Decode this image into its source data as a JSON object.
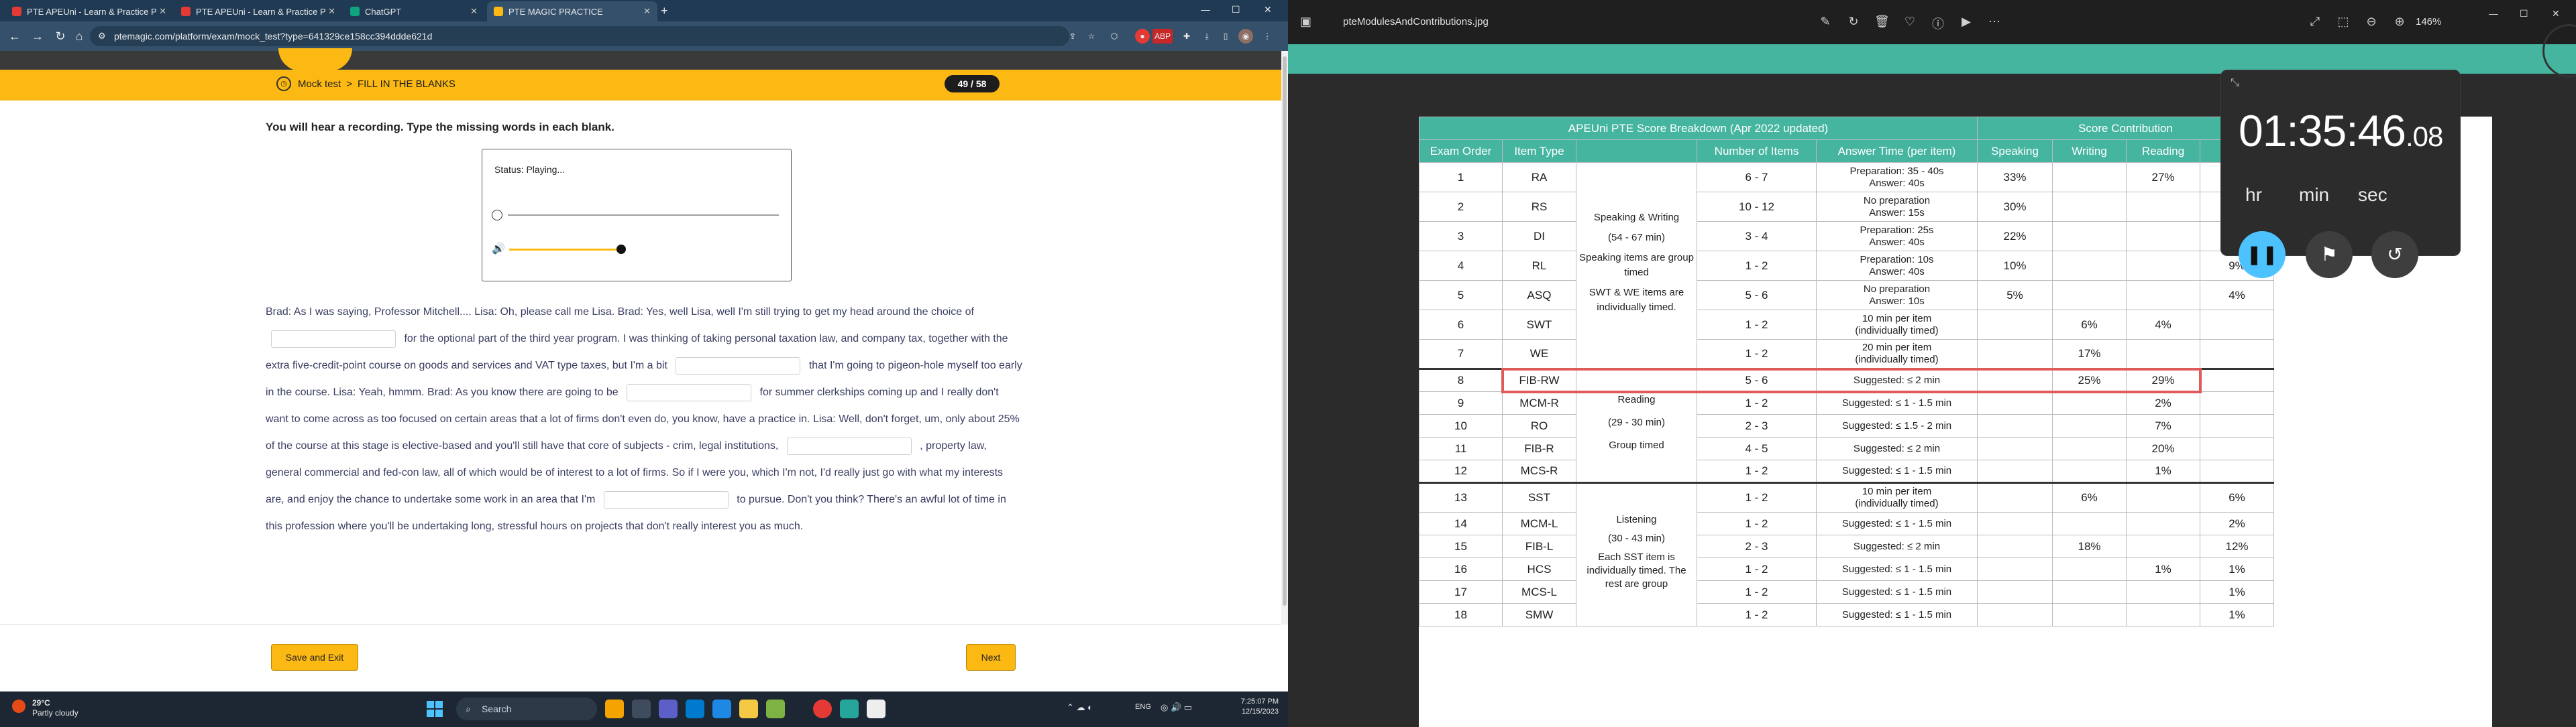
{
  "browser": {
    "tabs": [
      {
        "title": "PTE APEUni - Learn & Practice P",
        "active": false
      },
      {
        "title": "PTE APEUni - Learn & Practice P",
        "active": false
      },
      {
        "title": "PTE MAGIC PRACTICE",
        "active": true
      },
      {
        "title": "ChatGPT",
        "active": false
      }
    ],
    "new_tab": "+",
    "url": "ptemagic.com/platform/exam/mock_test?type=641329ce158cc394ddde621d",
    "window_controls": {
      "minimize": "—",
      "maximize": "☐",
      "close": "✕"
    }
  },
  "exam": {
    "breadcrumb_root": "Mock test",
    "breadcrumb_sep": ">",
    "breadcrumb_section": "FILL IN THE BLANKS",
    "counter": "49 / 58",
    "instruction": "You will hear a recording. Type the missing words in each blank.",
    "player_status": "Status: Playing...",
    "passage": [
      "Brad: As I was saying, Professor Mitchell.... Lisa: Oh, please call me Lisa. Brad: Yes, well Lisa, well I'm still trying to get my head around the choice of",
      "for the optional part of the third year program. I was thinking of taking personal taxation law, and company tax, together with the extra five-credit-point course on goods and services and VAT type taxes, but I'm a bit",
      "that I'm going to pigeon-hole myself too early in the course. Lisa: Yeah, hmmm. Brad: As you know there are going to be",
      "for summer clerkships coming up and I really don't want to come across as too focused on certain areas that a lot of firms don't even do, you know, have a practice in. Lisa: Well, don't forget, um, only about 25% of the course at this stage is elective-based and you'll still have that core of subjects - crim, legal institutions,",
      ", property law, general commercial and fed-con law, all of which would be of interest to a lot of firms. So if I were you, which I'm not, I'd really just go with what my interests are, and enjoy the chance to undertake some work in an area that I'm",
      "to pursue. Don't you think? There's an awful lot of time in this profession where you'll be undertaking long, stressful hours on projects that don't really interest you as much."
    ],
    "save_exit_label": "Save and Exit",
    "next_label": "Next"
  },
  "taskbar": {
    "weather_temp": "29°C",
    "weather_desc": "Partly cloudy",
    "search_placeholder": "Search",
    "lang": "ENG",
    "time": "7:25:07 PM",
    "date": "12/15/2023"
  },
  "viewer": {
    "filename": "pteModulesAndContributions.jpg",
    "zoom": "146%"
  },
  "score_table": {
    "title": "APEUni PTE Score Breakdown  (Apr 2022 updated)",
    "contribution_title": "Score Contribution",
    "headers": [
      "Exam Order",
      "Item Type",
      "",
      "Number of Items",
      "Answer Time (per item)",
      "Speaking",
      "Writing",
      "Reading",
      ""
    ],
    "speaking_group": [
      "Speaking & Writing",
      "(54 - 67 min)",
      "Speaking items are group timed",
      "SWT & WE items are individually timed."
    ],
    "reading_group": [
      "Reading",
      "(29 - 30 min)",
      "Group timed"
    ],
    "listening_group": [
      "Listening",
      "(30 - 43 min)",
      "Each SST item is individually timed. The rest are group"
    ],
    "rows": [
      {
        "order": "1",
        "type": "RA",
        "items": "6 - 7",
        "time": [
          "Preparation: 35 - 40s",
          "Answer: 40s"
        ],
        "speaking": "33%",
        "writing": "",
        "reading": "27%",
        "listening": ""
      },
      {
        "order": "2",
        "type": "RS",
        "items": "10 - 12",
        "time": [
          "No preparation",
          "Answer: 15s"
        ],
        "speaking": "30%",
        "writing": "",
        "reading": "",
        "listening": ""
      },
      {
        "order": "3",
        "type": "DI",
        "items": "3 - 4",
        "time": [
          "Preparation: 25s",
          "Answer: 40s"
        ],
        "speaking": "22%",
        "writing": "",
        "reading": "",
        "listening": ""
      },
      {
        "order": "4",
        "type": "RL",
        "items": "1 - 2",
        "time": [
          "Preparation: 10s",
          "Answer: 40s"
        ],
        "speaking": "10%",
        "writing": "",
        "reading": "",
        "listening": "9%"
      },
      {
        "order": "5",
        "type": "ASQ",
        "items": "5 - 6",
        "time": [
          "No preparation",
          "Answer: 10s"
        ],
        "speaking": "5%",
        "writing": "",
        "reading": "",
        "listening": "4%"
      },
      {
        "order": "6",
        "type": "SWT",
        "items": "1 - 2",
        "time": [
          "10 min per item",
          "(individually timed)"
        ],
        "speaking": "",
        "writing": "6%",
        "reading": "4%",
        "listening": ""
      },
      {
        "order": "7",
        "type": "WE",
        "items": "1 - 2",
        "time": [
          "20 min per item",
          "(individually timed)"
        ],
        "speaking": "",
        "writing": "17%",
        "reading": "",
        "listening": ""
      },
      {
        "order": "8",
        "type": "FIB-RW",
        "items": "5 - 6",
        "time": [
          "Suggested: ≤ 2 min"
        ],
        "speaking": "",
        "writing": "25%",
        "reading": "29%",
        "listening": ""
      },
      {
        "order": "9",
        "type": "MCM-R",
        "items": "1 - 2",
        "time": [
          "Suggested: ≤ 1 - 1.5 min"
        ],
        "speaking": "",
        "writing": "",
        "reading": "2%",
        "listening": ""
      },
      {
        "order": "10",
        "type": "RO",
        "items": "2 - 3",
        "time": [
          "Suggested: ≤ 1.5 - 2 min"
        ],
        "speaking": "",
        "writing": "",
        "reading": "7%",
        "listening": ""
      },
      {
        "order": "11",
        "type": "FIB-R",
        "items": "4 - 5",
        "time": [
          "Suggested: ≤ 2 min"
        ],
        "speaking": "",
        "writing": "",
        "reading": "20%",
        "listening": ""
      },
      {
        "order": "12",
        "type": "MCS-R",
        "items": "1 - 2",
        "time": [
          "Suggested: ≤ 1 - 1.5 min"
        ],
        "speaking": "",
        "writing": "",
        "reading": "1%",
        "listening": ""
      },
      {
        "order": "13",
        "type": "SST",
        "items": "1 - 2",
        "time": [
          "10 min per item",
          "(individually timed)"
        ],
        "speaking": "",
        "writing": "6%",
        "reading": "",
        "listening": "6%"
      },
      {
        "order": "14",
        "type": "MCM-L",
        "items": "1 - 2",
        "time": [
          "Suggested: ≤ 1 - 1.5 min"
        ],
        "speaking": "",
        "writing": "",
        "reading": "",
        "listening": "2%"
      },
      {
        "order": "15",
        "type": "FIB-L",
        "items": "2 - 3",
        "time": [
          "Suggested: ≤ 2 min"
        ],
        "speaking": "",
        "writing": "18%",
        "reading": "",
        "listening": "12%"
      },
      {
        "order": "16",
        "type": "HCS",
        "items": "1 - 2",
        "time": [
          "Suggested: ≤ 1 - 1.5 min"
        ],
        "speaking": "",
        "writing": "",
        "reading": "1%",
        "listening": "1%"
      },
      {
        "order": "17",
        "type": "MCS-L",
        "items": "1 - 2",
        "time": [
          "Suggested: ≤ 1 - 1.5 min"
        ],
        "speaking": "",
        "writing": "",
        "reading": "",
        "listening": "1%"
      },
      {
        "order": "18",
        "type": "SMW",
        "items": "1 - 2",
        "time": [
          "Suggested: ≤ 1 - 1.5 min"
        ],
        "speaking": "",
        "writing": "",
        "reading": "",
        "listening": "1%"
      }
    ]
  },
  "stopwatch": {
    "hours": "01",
    "minutes": "35",
    "seconds": "46",
    "hundredths": ".08",
    "label_hr": "hr",
    "label_min": "min",
    "label_sec": "sec"
  },
  "colors": {
    "accent_yellow": "#fdb913",
    "teal": "#45b5a0",
    "highlight_red": "#e05a5a",
    "pause_blue": "#4cc2ff"
  }
}
